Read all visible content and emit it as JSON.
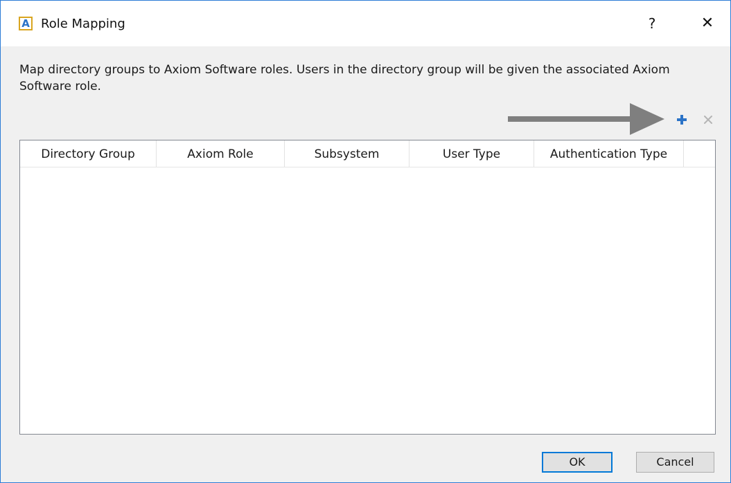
{
  "window": {
    "title": "Role Mapping",
    "app_icon_letter": "A",
    "help_label": "?",
    "close_label": "✕"
  },
  "instructions": "Map directory groups to Axiom Software roles. Users in the directory group will be given the associated Axiom Software role.",
  "toolbar": {
    "add_icon": "plus-icon",
    "remove_icon": "x-icon",
    "add_color": "#2b73c7",
    "remove_color": "#b5b5b5",
    "annotation_arrow_color": "#7f7f7f"
  },
  "grid": {
    "columns": [
      "Directory Group",
      "Axiom Role",
      "Subsystem",
      "User Type",
      "Authentication Type"
    ],
    "rows": []
  },
  "buttons": {
    "ok": "OK",
    "cancel": "Cancel"
  },
  "colors": {
    "window_border": "#2b7bd6",
    "dialog_background": "#f0f0f0",
    "default_button_border": "#0078d7"
  }
}
